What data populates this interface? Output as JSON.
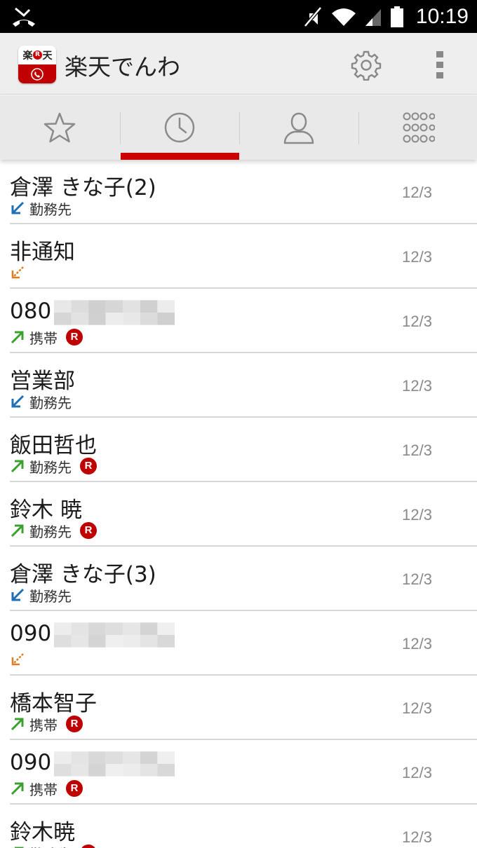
{
  "status_bar": {
    "time": "10:19"
  },
  "app": {
    "title": "楽天でんわ",
    "icon_top_left": "楽",
    "icon_top_badge": "R",
    "icon_top_right": "天"
  },
  "colors": {
    "accent": "#cc0000",
    "incoming": "#1f6fb5",
    "outgoing": "#3aa12f",
    "missed": "#e07b20"
  },
  "tabs": [
    {
      "name": "favorites",
      "icon": "star-icon"
    },
    {
      "name": "history",
      "icon": "clock-icon",
      "selected": true
    },
    {
      "name": "contacts",
      "icon": "person-icon"
    },
    {
      "name": "dialpad",
      "icon": "dialpad-icon"
    }
  ],
  "calls": [
    {
      "name": "倉澤 きな子(2)",
      "type": "incoming",
      "label": "勤務先",
      "rakuten": false,
      "date": "12/3"
    },
    {
      "name": "非通知",
      "type": "missed",
      "label": "",
      "rakuten": false,
      "date": "12/3"
    },
    {
      "name": "080",
      "masked": true,
      "type": "outgoing",
      "label": "携帯",
      "rakuten": true,
      "badge": "R",
      "date": "12/3"
    },
    {
      "name": "営業部",
      "type": "incoming",
      "label": "勤務先",
      "rakuten": false,
      "date": "12/3"
    },
    {
      "name": "飯田哲也",
      "type": "outgoing",
      "label": "勤務先",
      "rakuten": true,
      "badge": "R",
      "date": "12/3"
    },
    {
      "name": "鈴木 暁",
      "type": "outgoing",
      "label": "勤務先",
      "rakuten": true,
      "badge": "R",
      "date": "12/3"
    },
    {
      "name": "倉澤 きな子(3)",
      "type": "incoming",
      "label": "勤務先",
      "rakuten": false,
      "date": "12/3"
    },
    {
      "name": "090",
      "masked": true,
      "type": "missed",
      "label": "",
      "rakuten": false,
      "date": "12/3"
    },
    {
      "name": "橋本智子",
      "type": "outgoing",
      "label": "携帯",
      "rakuten": true,
      "badge": "R",
      "date": "12/3"
    },
    {
      "name": "090",
      "masked": true,
      "type": "outgoing",
      "label": "携帯",
      "rakuten": true,
      "badge": "R",
      "date": "12/3"
    },
    {
      "name": "鈴木暁",
      "type": "outgoing",
      "label": "勤務先",
      "rakuten": true,
      "badge": "R",
      "date": "12/3"
    }
  ]
}
